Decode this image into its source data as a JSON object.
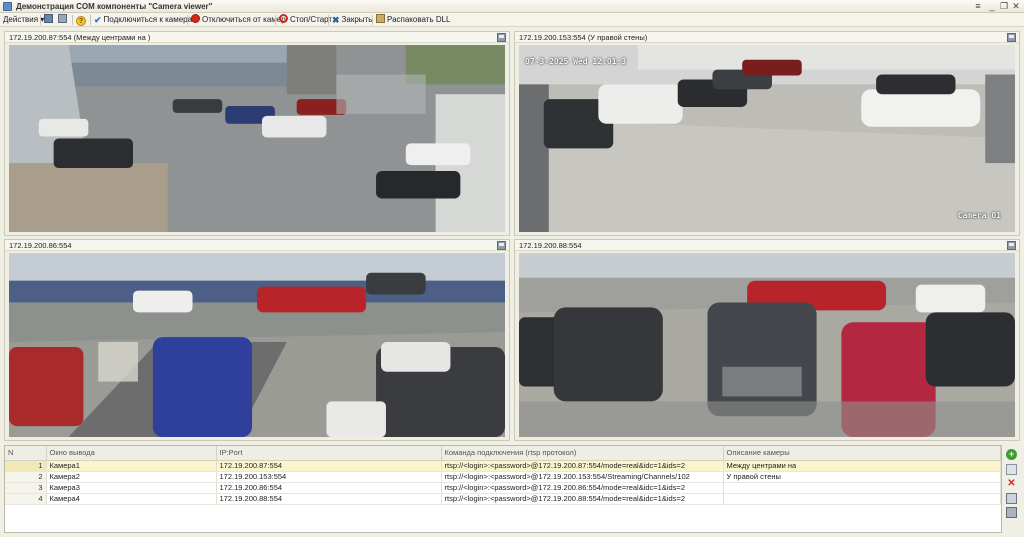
{
  "window": {
    "title": "Демонстрация COM компоненты \"Camera viewer\""
  },
  "toolbar": {
    "actions_label": "Действия",
    "connect_label": "Подключиться к камерам",
    "disconnect_label": "Отключиться от камер",
    "stopstart_label": "Стоп/Старт",
    "close_label": "Закрыть",
    "unpack_label": "Распаковать DLL"
  },
  "panels": [
    {
      "caption": "172.19.200.87:554 (Между центрами на             )"
    },
    {
      "caption": "172.19.200.153:554 (У правой стены)",
      "overlay_date": "07-3-2025 Wed 12:01:3",
      "overlay_camera": "Camera 01"
    },
    {
      "caption": "172.19.200.86:554"
    },
    {
      "caption": "172.19.200.88:554"
    }
  ],
  "grid": {
    "columns": [
      "N",
      "Окно вывода",
      "IP:Port",
      "Команда подключения (rtsp протокол)",
      "Описание камеры"
    ],
    "rows": [
      {
        "n": "1",
        "window": "Камера1",
        "ip": "172.19.200.87:554",
        "cmd": "rtsp://<login>:<password>@172.19.200.87:554/mode=real&idc=1&ids=2",
        "desc": "Между центрами на"
      },
      {
        "n": "2",
        "window": "Камера2",
        "ip": "172.19.200.153:554",
        "cmd": "rtsp://<login>:<password>@172.19.200.153:554/Streaming/Channels/102",
        "desc": "У правой стены"
      },
      {
        "n": "3",
        "window": "Камера3",
        "ip": "172.19.200.86:554",
        "cmd": "rtsp://<login>:<password>@172.19.200.86:554/mode=real&idc=1&ids=2",
        "desc": ""
      },
      {
        "n": "4",
        "window": "Камера4",
        "ip": "172.19.200.88:554",
        "cmd": "rtsp://<login>:<password>@172.19.200.88:554/mode=real&idc=1&ids=2",
        "desc": ""
      }
    ]
  },
  "icons": {
    "add": "plus-circle-icon",
    "copy": "copy-icon",
    "delete": "red-x-icon",
    "edit": "edit-icon",
    "save": "floppy-icon"
  },
  "colors": {
    "selected_row": "#fbf5cd",
    "accent_red": "#d6271f",
    "accent_green": "#3e9b32"
  }
}
